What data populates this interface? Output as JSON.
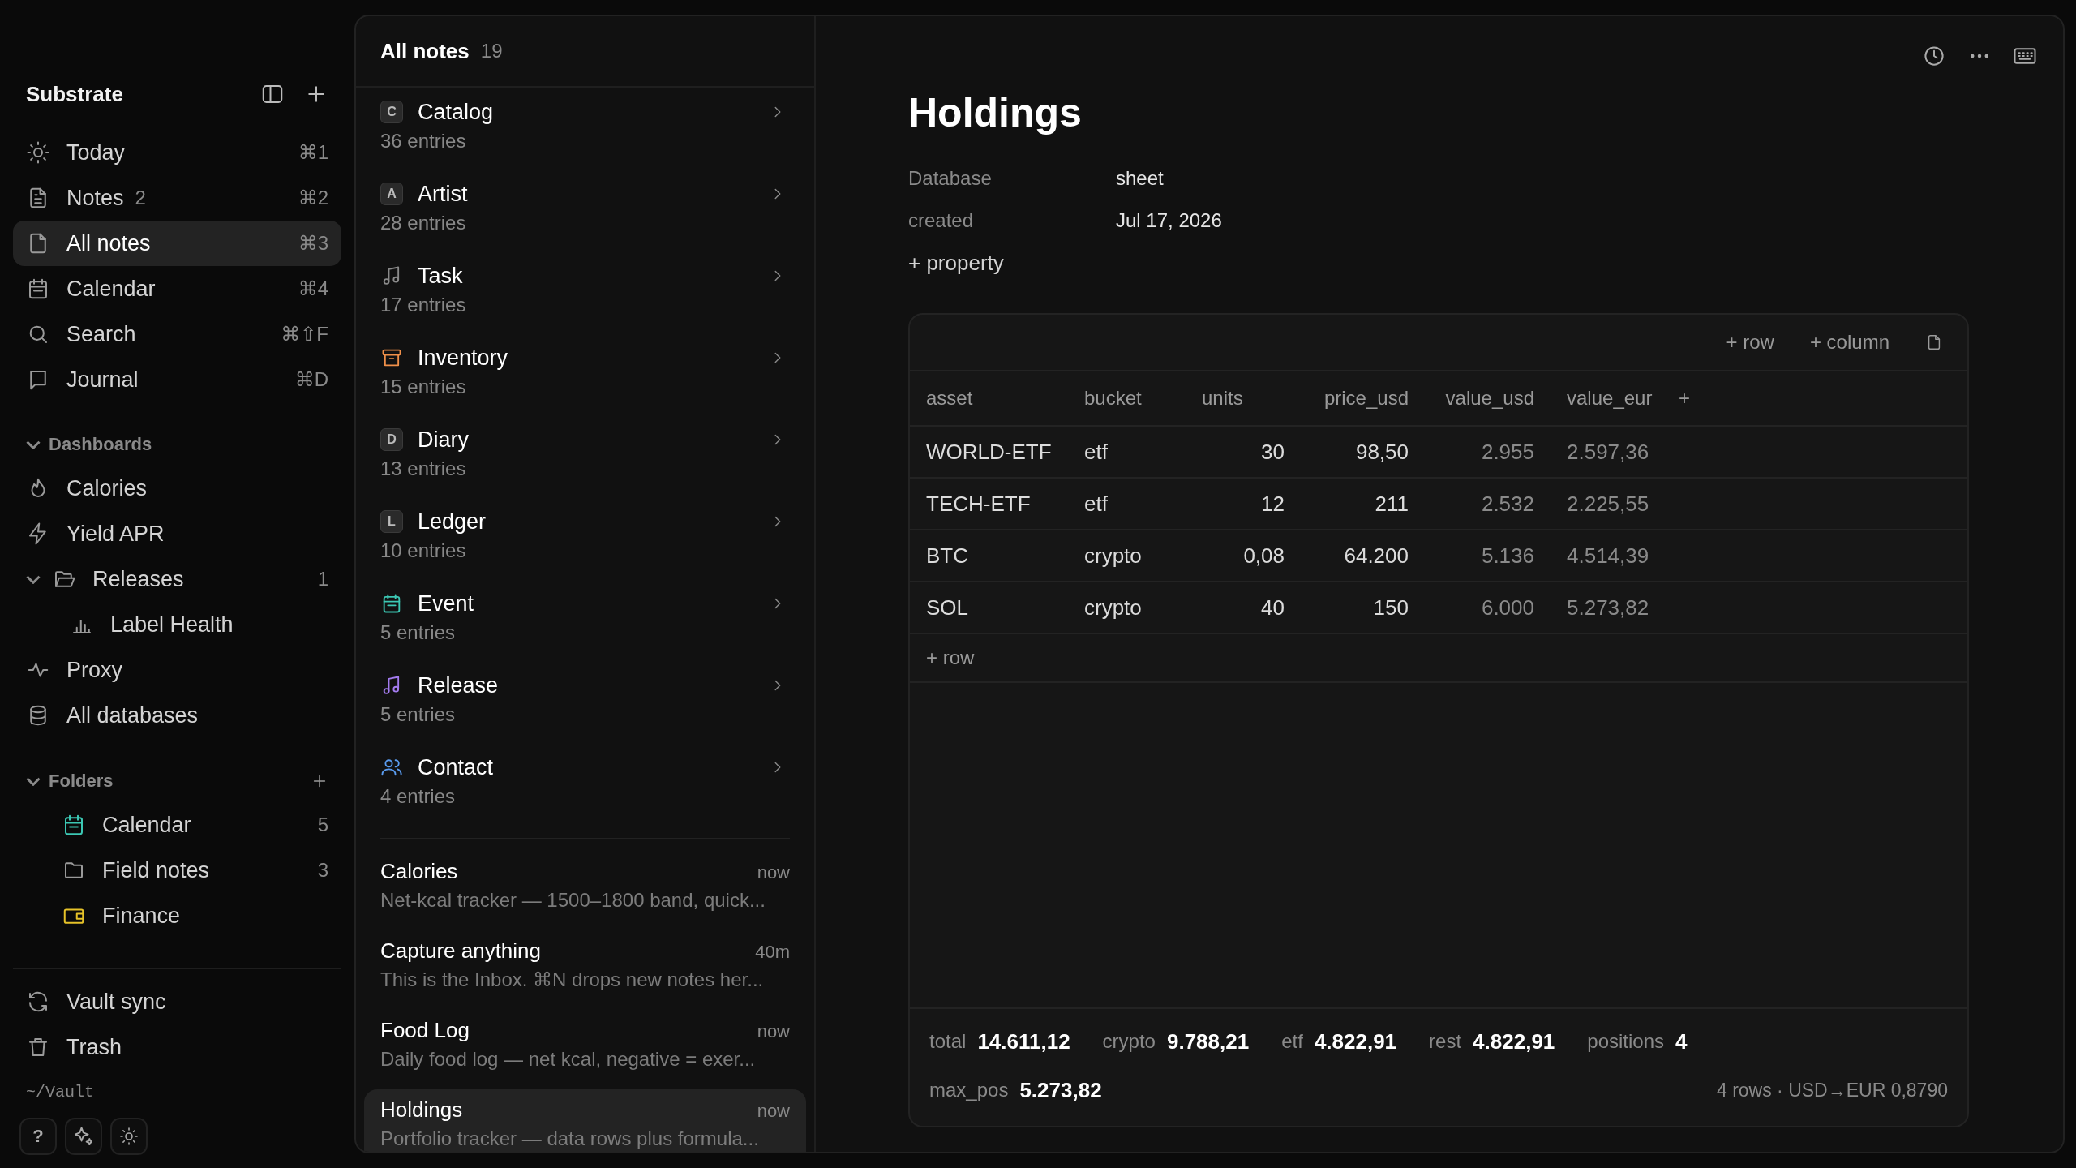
{
  "sidebar": {
    "title": "Substrate",
    "nav": [
      {
        "label": "Today",
        "kind": "sun",
        "shortcut": "⌘1",
        "selected": false
      },
      {
        "label": "Notes",
        "kind": "filetext",
        "count": "2",
        "shortcut": "⌘2",
        "selected": false
      },
      {
        "label": "All notes",
        "kind": "file",
        "shortcut": "⌘3",
        "selected": true
      },
      {
        "label": "Calendar",
        "kind": "calendar",
        "shortcut": "⌘4",
        "selected": false
      },
      {
        "label": "Search",
        "kind": "search",
        "shortcut": "⌘⇧F",
        "selected": false
      },
      {
        "label": "Journal",
        "kind": "book",
        "shortcut": "⌘D",
        "selected": false
      }
    ],
    "dashboards": {
      "label": "Dashboards",
      "expanded": true,
      "items": [
        {
          "label": "Calories",
          "kind": "flame"
        },
        {
          "label": "Yield APR",
          "kind": "bolt"
        },
        {
          "label": "Releases",
          "kind": "folderopen",
          "count": "1",
          "expanded": true,
          "children": [
            {
              "label": "Label Health",
              "kind": "bars"
            }
          ]
        },
        {
          "label": "Proxy",
          "kind": "pulse"
        },
        {
          "label": "All databases",
          "kind": "database"
        }
      ]
    },
    "folders": {
      "label": "Folders",
      "expanded": true,
      "items": [
        {
          "label": "Calendar",
          "kind": "calendar",
          "color": "#3cc8b4",
          "count": "5"
        },
        {
          "label": "Field notes",
          "kind": "folder",
          "color": "#9a9a9a",
          "count": "3"
        },
        {
          "label": "Finance",
          "kind": "wallet",
          "color": "#e6c229"
        }
      ]
    },
    "footer": [
      {
        "label": "Vault sync",
        "kind": "sync"
      },
      {
        "label": "Trash",
        "kind": "trash"
      }
    ],
    "vault_path": "~/Vault",
    "bottom_buttons": [
      {
        "kind": "text",
        "label": "?"
      },
      {
        "kind": "sparkles"
      },
      {
        "kind": "sun"
      }
    ]
  },
  "list": {
    "title": "All notes",
    "count": "19",
    "databases": [
      {
        "name": "Catalog",
        "entries": "36 entries",
        "kind": "letter",
        "badge": "C"
      },
      {
        "name": "Artist",
        "entries": "28 entries",
        "kind": "letter",
        "badge": "A"
      },
      {
        "name": "Task",
        "entries": "17 entries",
        "kind": "note",
        "color": "#8a8a8a"
      },
      {
        "name": "Inventory",
        "entries": "15 entries",
        "kind": "archive",
        "color": "#f0904a"
      },
      {
        "name": "Diary",
        "entries": "13 entries",
        "kind": "letter",
        "badge": "D"
      },
      {
        "name": "Ledger",
        "entries": "10 entries",
        "kind": "letter",
        "badge": "L"
      },
      {
        "name": "Event",
        "entries": "5 entries",
        "kind": "calendar",
        "color": "#3cc8b4"
      },
      {
        "name": "Release",
        "entries": "5 entries",
        "kind": "music",
        "color": "#a47cf0"
      },
      {
        "name": "Contact",
        "entries": "4 entries",
        "kind": "people",
        "color": "#5a9cf0"
      }
    ],
    "notes": [
      {
        "title": "Calories",
        "time": "now",
        "snippet": "Net-kcal tracker — 1500–1800 band, quick...",
        "selected": false
      },
      {
        "title": "Capture anything",
        "time": "40m",
        "snippet": "This is the Inbox. ⌘N drops new notes her...",
        "selected": false
      },
      {
        "title": "Food Log",
        "time": "now",
        "snippet": "Daily food log — net kcal, negative = exer...",
        "selected": false
      },
      {
        "title": "Holdings",
        "time": "now",
        "snippet": "Portfolio tracker — data rows plus formula...",
        "selected": true
      }
    ]
  },
  "document": {
    "title": "Holdings",
    "properties": [
      {
        "name": "Database",
        "value": "sheet"
      },
      {
        "name": "created",
        "value": "Jul 17, 2026"
      }
    ],
    "add_property": "+ property",
    "sheet": {
      "toolbar": [
        "+ row",
        "+ column"
      ],
      "columns": [
        "asset",
        "bucket",
        "units",
        "price_usd",
        "value_usd",
        "value_eur"
      ],
      "add_column": "+",
      "rows": [
        [
          "WORLD-ETF",
          "etf",
          "30",
          "98,50",
          "2.955",
          "2.597,36"
        ],
        [
          "TECH-ETF",
          "etf",
          "12",
          "211",
          "2.532",
          "2.225,55"
        ],
        [
          "BTC",
          "crypto",
          "0,08",
          "64.200",
          "5.136",
          "4.514,39"
        ],
        [
          "SOL",
          "crypto",
          "40",
          "150",
          "6.000",
          "5.273,82"
        ]
      ],
      "add_row": "+ row",
      "stats": [
        {
          "label": "total",
          "value": "14.611,12"
        },
        {
          "label": "crypto",
          "value": "9.788,21"
        },
        {
          "label": "etf",
          "value": "4.822,91"
        },
        {
          "label": "rest",
          "value": "4.822,91"
        },
        {
          "label": "positions",
          "value": "4"
        }
      ],
      "stats_2": [
        {
          "label": "max_pos",
          "value": "5.273,82"
        }
      ],
      "summary": "4 rows · USD→EUR 0,8790"
    }
  }
}
